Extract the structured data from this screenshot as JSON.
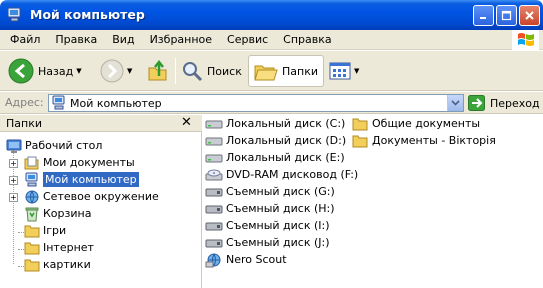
{
  "window": {
    "title": "Мой компьютер"
  },
  "menu": [
    "Файл",
    "Правка",
    "Вид",
    "Избранное",
    "Сервис",
    "Справка"
  ],
  "toolbar": {
    "back": "Назад",
    "search": "Поиск",
    "folders": "Папки"
  },
  "address": {
    "label": "Адрес:",
    "value": "Мой компьютер",
    "go": "Переход"
  },
  "folders_pane": {
    "title": "Папки",
    "tree": [
      {
        "label": "Рабочий стол",
        "icon": "desktop-icon"
      },
      {
        "label": "Мои документы",
        "icon": "my-documents-icon",
        "expander": "+"
      },
      {
        "label": "Мой компьютер",
        "icon": "my-computer-icon",
        "expander": "+",
        "selected": true
      },
      {
        "label": "Сетевое окружение",
        "icon": "network-icon",
        "expander": "+"
      },
      {
        "label": "Корзина",
        "icon": "recycle-bin-icon"
      },
      {
        "label": "Ігри",
        "icon": "folder-icon"
      },
      {
        "label": "Інтернет",
        "icon": "folder-icon"
      },
      {
        "label": "картики",
        "icon": "folder-icon"
      }
    ]
  },
  "content": {
    "drives": [
      {
        "label": "Локальный диск (C:)",
        "icon": "drive-icon"
      },
      {
        "label": "Локальный диск (D:)",
        "icon": "drive-icon"
      },
      {
        "label": "Локальный диск (E:)",
        "icon": "drive-icon"
      },
      {
        "label": "DVD-RAM дисковод (F:)",
        "icon": "dvd-icon"
      },
      {
        "label": "Съемный диск (G:)",
        "icon": "removable-drive-icon"
      },
      {
        "label": "Съемный диск (H:)",
        "icon": "removable-drive-icon"
      },
      {
        "label": "Съемный диск (I:)",
        "icon": "removable-drive-icon"
      },
      {
        "label": "Съемный диск (J:)",
        "icon": "removable-drive-icon"
      },
      {
        "label": "Nero Scout",
        "icon": "nero-scout-icon"
      }
    ],
    "shared": [
      {
        "label": "Общие документы",
        "icon": "folder-icon"
      },
      {
        "label": "Документы - Вікторія",
        "icon": "folder-icon"
      }
    ]
  },
  "colors": {
    "titlebar": "#0054e3",
    "selection": "#316ac5",
    "chrome": "#ece9d8",
    "folder": "#f2cf5a"
  }
}
